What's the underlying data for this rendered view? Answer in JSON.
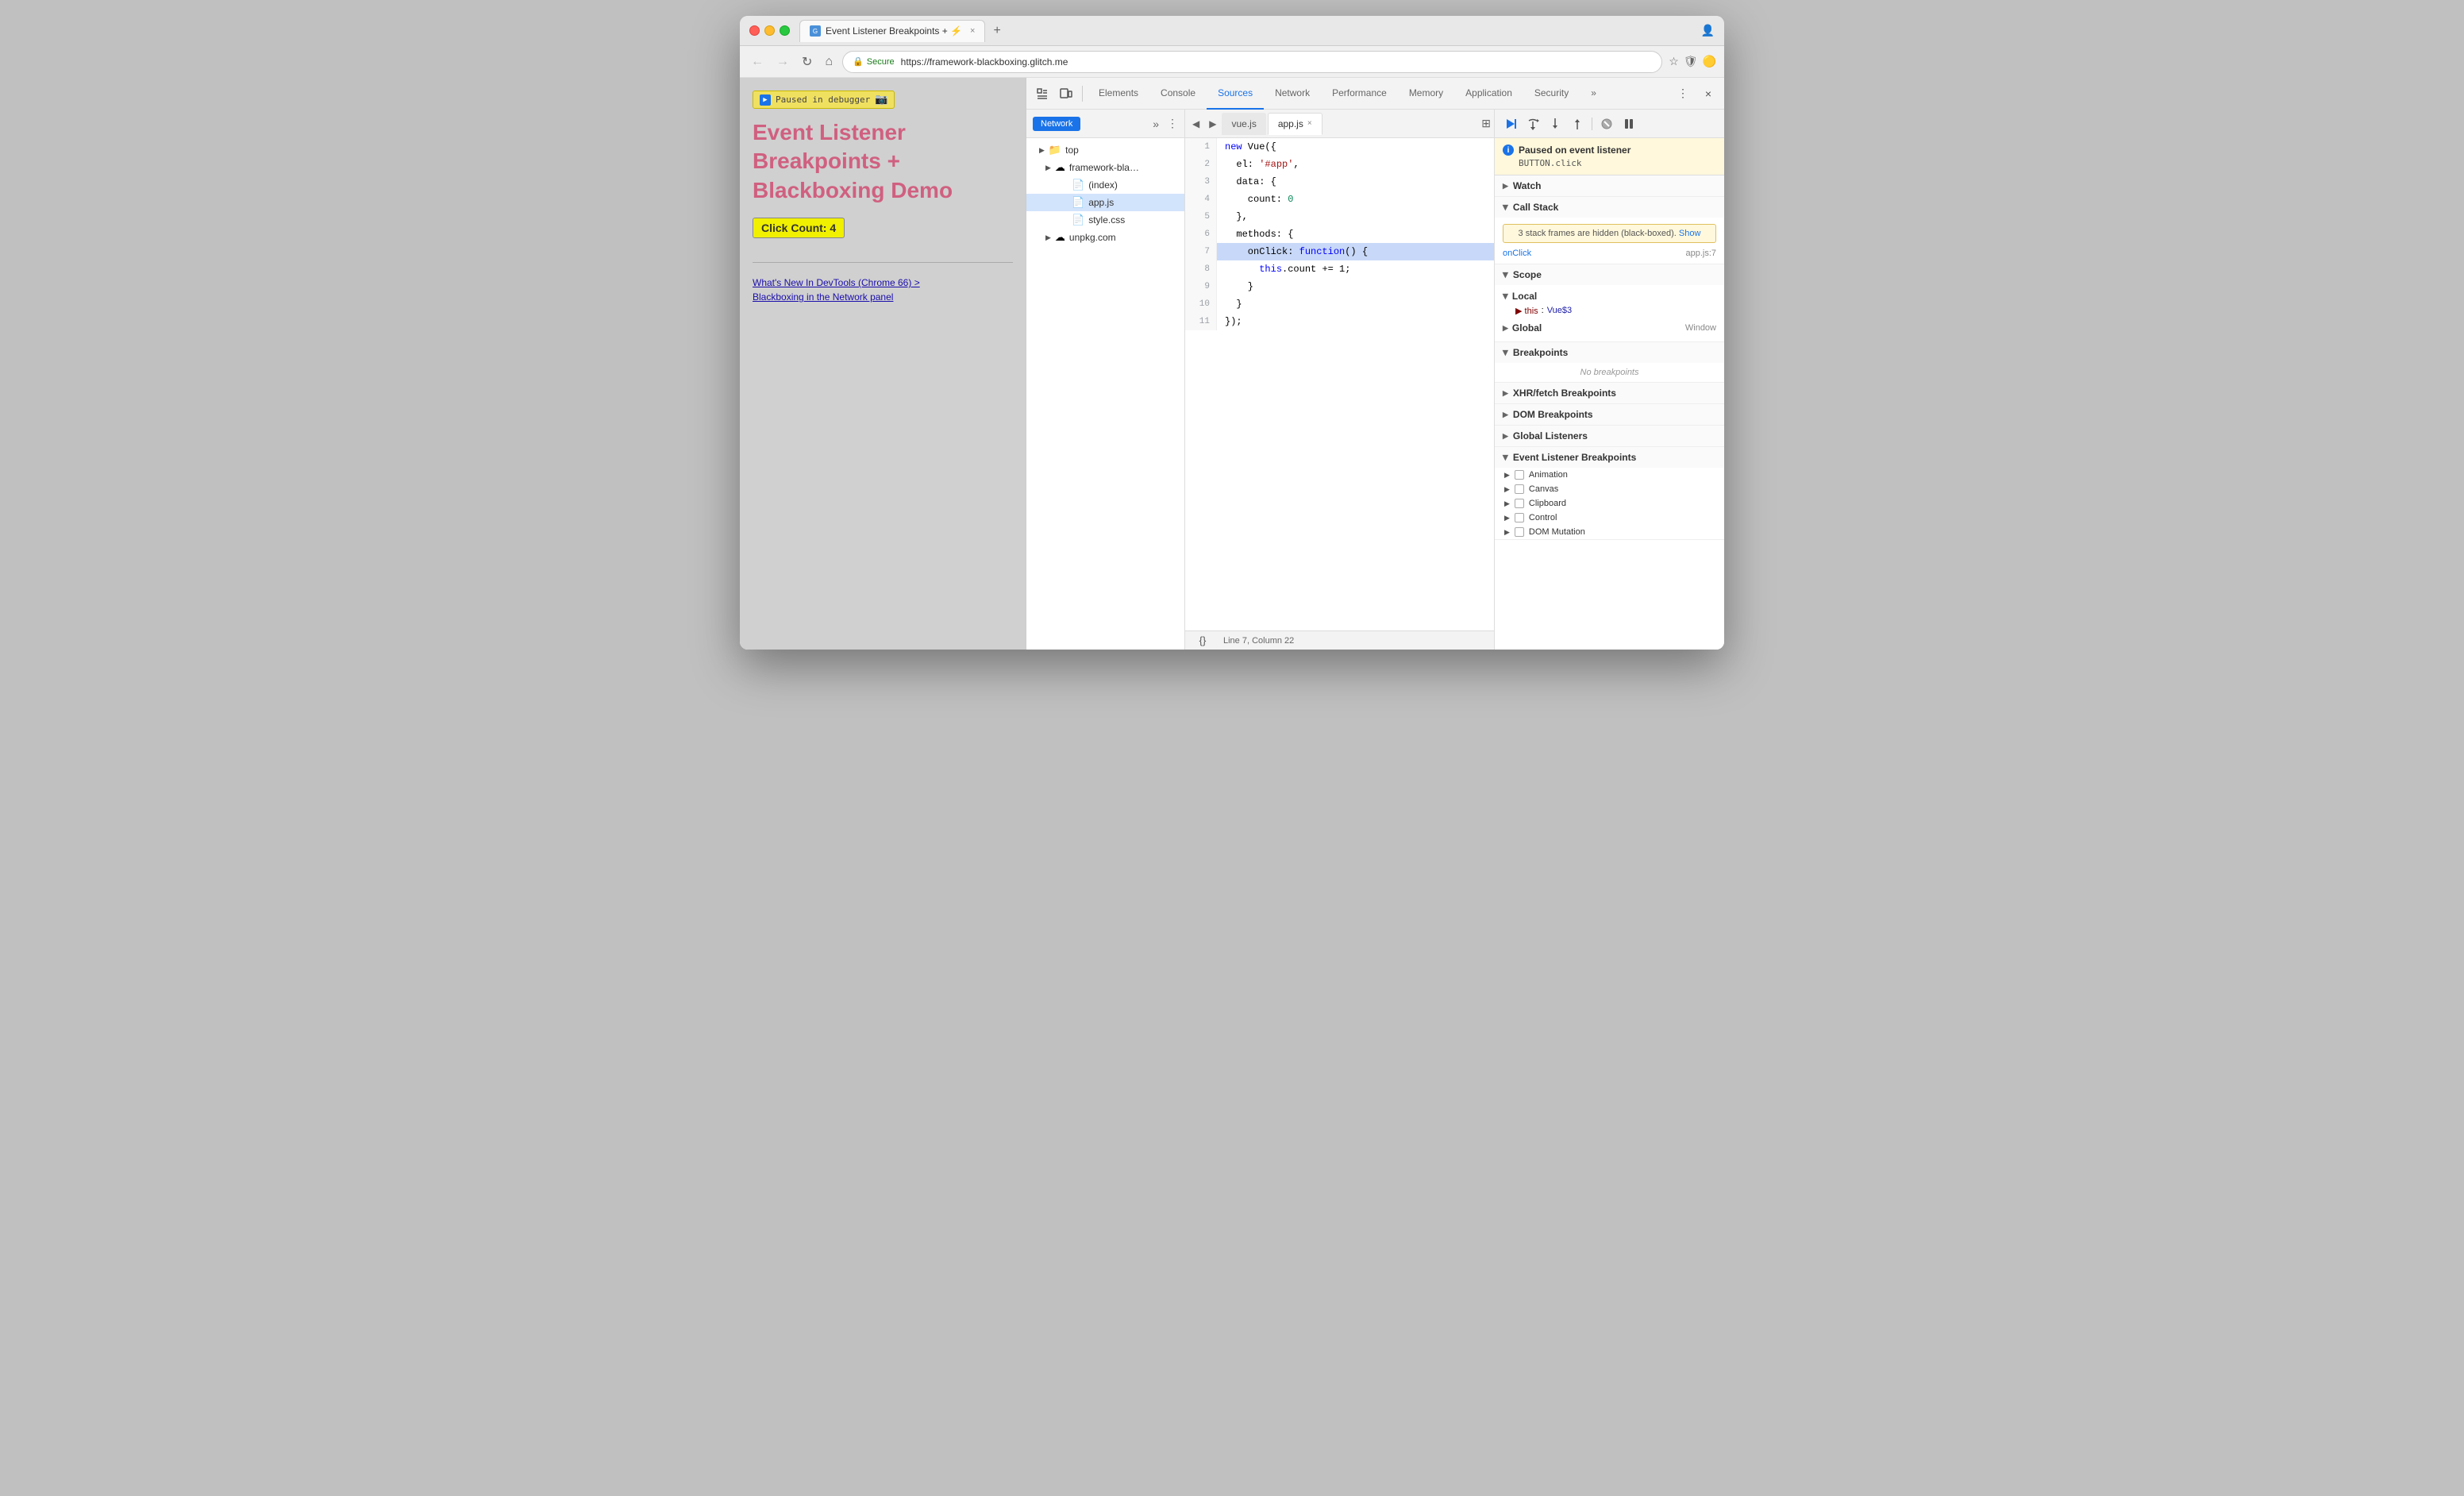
{
  "browser": {
    "tab_title": "Event Listener Breakpoints + ⚡",
    "tab_close": "×",
    "new_tab": "+",
    "url_secure_label": "Secure",
    "url": "https://framework-blackboxing.glitch.me",
    "nav_back": "←",
    "nav_forward": "→",
    "nav_refresh": "↻",
    "nav_home": "⌂"
  },
  "webpage": {
    "paused_label": "Paused in debugger",
    "title": "Event Listener Breakpoints + Blackboxing Demo",
    "click_count": "Click Count: 4",
    "link1": "What's New In DevTools (Chrome 66) >",
    "link2": "Blackboxing in the Network panel"
  },
  "devtools": {
    "tabs": [
      {
        "label": "Elements",
        "active": false
      },
      {
        "label": "Console",
        "active": false
      },
      {
        "label": "Sources",
        "active": true
      },
      {
        "label": "Network",
        "active": false
      },
      {
        "label": "Performance",
        "active": false
      },
      {
        "label": "Memory",
        "active": false
      },
      {
        "label": "Application",
        "active": false
      },
      {
        "label": "Security",
        "active": false
      }
    ],
    "more_tabs": "»",
    "settings_icon": "⋮",
    "close_icon": "×"
  },
  "sources": {
    "sidebar_tabs": [
      {
        "label": "Network",
        "active": true
      }
    ],
    "tree": [
      {
        "label": "top",
        "indent": 0,
        "type": "arrow",
        "expanded": true
      },
      {
        "label": "framework-bla…",
        "indent": 1,
        "type": "cloud",
        "expanded": true
      },
      {
        "label": "(index)",
        "indent": 2,
        "type": "file"
      },
      {
        "label": "app.js",
        "indent": 2,
        "type": "file-yellow"
      },
      {
        "label": "style.css",
        "indent": 2,
        "type": "file-purple"
      },
      {
        "label": "unpkg.com",
        "indent": 1,
        "type": "cloud",
        "expanded": false
      }
    ],
    "editor_tabs": [
      {
        "label": "vue.js",
        "active": false,
        "closeable": false
      },
      {
        "label": "app.js",
        "active": true,
        "closeable": true
      }
    ],
    "code_lines": [
      {
        "num": "1",
        "code": "new Vue({",
        "tokens": [
          {
            "t": "kw",
            "v": "new"
          },
          {
            "t": "",
            "v": " Vue({"
          }
        ]
      },
      {
        "num": "2",
        "code": "  el: '#app',",
        "tokens": [
          {
            "t": "",
            "v": "  el: "
          },
          {
            "t": "string",
            "v": "'#app'"
          },
          {
            "t": "",
            "v": ","
          }
        ]
      },
      {
        "num": "3",
        "code": "  data: {",
        "tokens": [
          {
            "t": "",
            "v": "  data: {"
          }
        ]
      },
      {
        "num": "4",
        "code": "    count: 0",
        "tokens": [
          {
            "t": "",
            "v": "    count: "
          },
          {
            "t": "number",
            "v": "0"
          }
        ]
      },
      {
        "num": "5",
        "code": "  },",
        "tokens": [
          {
            "t": "",
            "v": "  },"
          }
        ]
      },
      {
        "num": "6",
        "code": "  methods: {",
        "tokens": [
          {
            "t": "",
            "v": "  methods: {"
          }
        ]
      },
      {
        "num": "7",
        "code": "    onClick: function() {",
        "tokens": [
          {
            "t": "",
            "v": "    onClick: "
          },
          {
            "t": "kw",
            "v": "function"
          },
          {
            "t": "",
            "v": "() {"
          }
        ],
        "active": true
      },
      {
        "num": "8",
        "code": "      this.count += 1;",
        "tokens": [
          {
            "t": "",
            "v": "      "
          },
          {
            "t": "kw",
            "v": "this"
          },
          {
            "t": "",
            "v": ".count += 1;"
          }
        ]
      },
      {
        "num": "9",
        "code": "    }",
        "tokens": [
          {
            "t": "",
            "v": "    }"
          }
        ]
      },
      {
        "num": "10",
        "code": "  }",
        "tokens": [
          {
            "t": "",
            "v": "  }"
          }
        ]
      },
      {
        "num": "11",
        "code": "});",
        "tokens": [
          {
            "t": "",
            "v": "});"
          }
        ]
      }
    ],
    "status_bar": {
      "format_btn": "{}",
      "position": "Line 7, Column 22"
    }
  },
  "debugger": {
    "toolbar_btns": [
      "▶▶",
      "↷",
      "↓",
      "↑",
      "⬚↙",
      "⏸"
    ],
    "paused_title": "Paused on event listener",
    "paused_subtitle": "BUTTON.click",
    "sections": {
      "watch": {
        "label": "Watch",
        "expanded": false
      },
      "call_stack": {
        "label": "Call Stack",
        "expanded": true,
        "warning": "3 stack frames are hidden (black-boxed).",
        "warning_link": "Show",
        "items": [
          {
            "fn": "onClick",
            "loc": "app.js:7"
          }
        ]
      },
      "scope": {
        "label": "Scope",
        "expanded": true,
        "local": {
          "label": "Local",
          "items": [
            {
              "key": "▶ this",
              "val": "Vue$3"
            }
          ]
        },
        "global": {
          "label": "Global",
          "val": "Window"
        }
      },
      "breakpoints": {
        "label": "Breakpoints",
        "expanded": true,
        "empty_msg": "No breakpoints"
      },
      "xhr_breakpoints": {
        "label": "XHR/fetch Breakpoints",
        "expanded": false
      },
      "dom_breakpoints": {
        "label": "DOM Breakpoints",
        "expanded": false
      },
      "global_listeners": {
        "label": "Global Listeners",
        "expanded": false
      },
      "event_listener_bp": {
        "label": "Event Listener Breakpoints",
        "expanded": true,
        "items": [
          {
            "label": "Animation"
          },
          {
            "label": "Canvas"
          },
          {
            "label": "Clipboard"
          },
          {
            "label": "Control"
          },
          {
            "label": "DOM Mutation"
          }
        ]
      }
    }
  }
}
